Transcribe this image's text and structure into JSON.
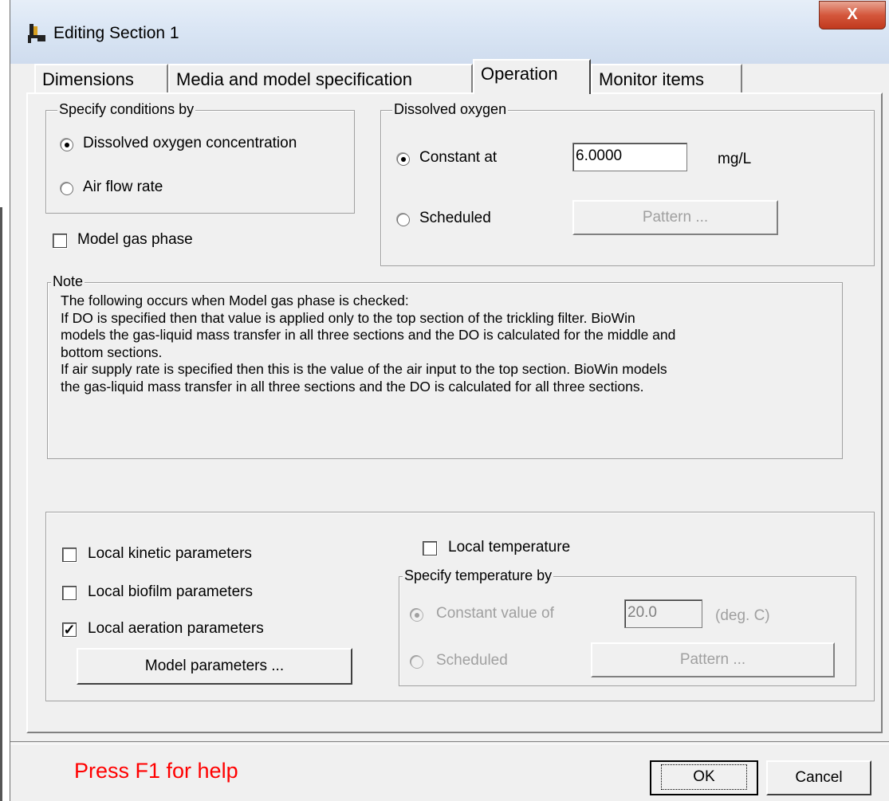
{
  "window": {
    "title": "Editing Section 1",
    "close_label": "X"
  },
  "tabs": [
    {
      "label": "Dimensions"
    },
    {
      "label": "Media and model specification"
    },
    {
      "label": "Operation"
    },
    {
      "label": "Monitor items"
    }
  ],
  "specify_conditions": {
    "legend": "Specify conditions by",
    "option1": "Dissolved oxygen concentration",
    "option2": "Air flow rate",
    "selected": "Dissolved oxygen concentration"
  },
  "model_gas_phase": {
    "label": "Model gas phase",
    "checked": false
  },
  "dissolved_oxygen": {
    "legend": "Dissolved oxygen",
    "constant_label": "Constant at",
    "constant_value": "6.0000",
    "unit": "mg/L",
    "scheduled_label": "Scheduled",
    "pattern_button": "Pattern ..."
  },
  "note": {
    "legend": "Note",
    "lines": [
      "The following occurs when Model gas phase is checked:",
      "If DO is specified then that value is applied only to the top section of the trickling filter. BioWin",
      "models the gas-liquid mass transfer in all three sections and the DO is calculated for the middle and",
      "bottom sections.",
      "If air supply rate is specified then this is the value of the air input to the top section. BioWin models",
      "the gas-liquid mass transfer in all three sections and the DO is calculated for all three sections."
    ]
  },
  "local": {
    "kinetic": {
      "label": "Local kinetic parameters",
      "checked": false
    },
    "biofilm": {
      "label": "Local biofilm parameters",
      "checked": false
    },
    "aeration": {
      "label": "Local aeration parameters",
      "checked": true
    },
    "model_params_button": "Model parameters ...",
    "temperature": {
      "label": "Local temperature",
      "checked": false
    }
  },
  "temperature": {
    "legend": "Specify temperature by",
    "constant_label": "Constant value of",
    "constant_value": "20.0",
    "unit": "(deg. C)",
    "scheduled_label": "Scheduled",
    "pattern_button": "Pattern ..."
  },
  "footer": {
    "help": "Press F1 for help",
    "ok": "OK",
    "cancel": "Cancel"
  }
}
